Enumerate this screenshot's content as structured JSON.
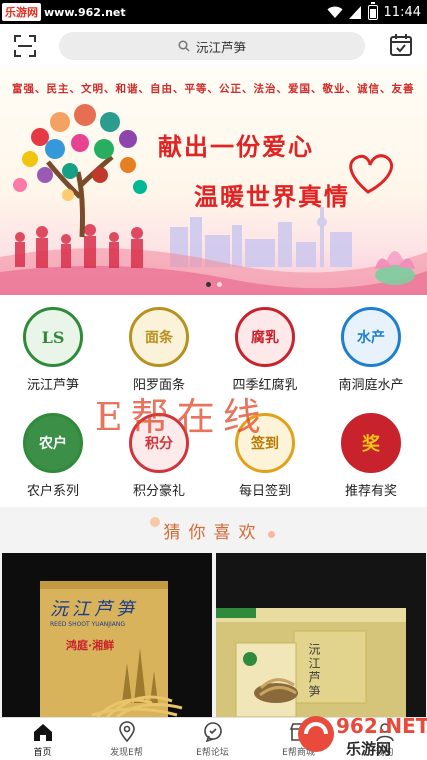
{
  "status_bar": {
    "site_logo": "乐游网",
    "site_url": "www.962.net",
    "time": "11:44"
  },
  "header": {
    "search_placeholder": "沅江芦笋"
  },
  "banner": {
    "values_text": "富强、民主、文明、和谐、自由、平等、公正、法治、爱国、敬业、诚信、友善",
    "headline_1": "献出一份爱心",
    "headline_2": "温暖世界真情",
    "pagination_count": 2,
    "active_page": 1
  },
  "categories": [
    {
      "label": "沅江芦笋",
      "badge": "LS",
      "color": "#2f8a3a"
    },
    {
      "label": "阳罗面条",
      "badge": "面条",
      "color": "#b8911f"
    },
    {
      "label": "四季红腐乳",
      "badge": "腐乳",
      "color": "#c8232c"
    },
    {
      "label": "南洞庭水产",
      "badge": "水产",
      "color": "#1e7fcf"
    },
    {
      "label": "农户系列",
      "badge": "农户",
      "color": "#2f8a3a"
    },
    {
      "label": "积分豪礼",
      "badge": "积分",
      "color": "#d1343a"
    },
    {
      "label": "每日签到",
      "badge": "签到",
      "color": "#e2a11b"
    },
    {
      "label": "推荐有奖",
      "badge": "奖",
      "color": "#c8232c"
    }
  ],
  "watermark": "E帮在线",
  "section": {
    "title": "猜你喜欢"
  },
  "products": [
    {
      "brand": "沅江芦笋",
      "sub": "REED SHOOT YUANJIANG",
      "tag": "鸿庭·湘鲜"
    },
    {
      "brand": "沅江芦笋"
    }
  ],
  "tabbar": {
    "tabs": [
      {
        "label": "首页",
        "icon": "home-icon",
        "active": true
      },
      {
        "label": "发现E帮",
        "icon": "location-icon",
        "active": false
      },
      {
        "label": "E帮论坛",
        "icon": "chat-icon",
        "active": false
      },
      {
        "label": "E帮商城",
        "icon": "shop-icon",
        "active": false
      },
      {
        "label": "我的",
        "icon": "user-icon",
        "active": false
      }
    ]
  },
  "site_watermark": {
    "text": "962.NET",
    "sub": "乐游网"
  },
  "colors": {
    "accent": "#d76a35",
    "brand_red": "#e02424"
  }
}
